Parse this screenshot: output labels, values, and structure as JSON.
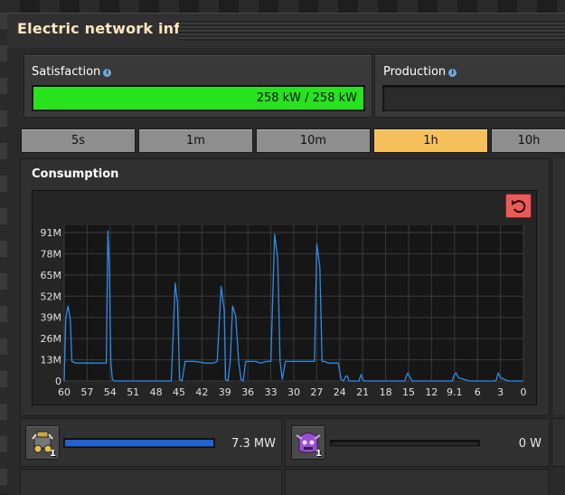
{
  "window": {
    "title": "Electric network info"
  },
  "satisfaction": {
    "label": "Satisfaction",
    "value_text": "258 kW / 258 kW",
    "fill": 1.0,
    "color": "#27e31e"
  },
  "production": {
    "label": "Production",
    "fill": 0.0
  },
  "time_tabs": [
    {
      "label": "5s",
      "active": false
    },
    {
      "label": "1m",
      "active": false
    },
    {
      "label": "10m",
      "active": false
    },
    {
      "label": "1h",
      "active": true
    },
    {
      "label": "10h",
      "active": false
    }
  ],
  "consumption": {
    "label": "Consumption",
    "reset_icon": "undo-icon"
  },
  "chart_data": {
    "type": "line",
    "title": "",
    "xlabel": "",
    "ylabel": "",
    "x_reversed": true,
    "xlim": [
      60,
      0
    ],
    "ylim": [
      0,
      91
    ],
    "y_unit": "M",
    "x_ticks": [
      "60",
      "57",
      "54",
      "51",
      "48",
      "45",
      "42",
      "39",
      "36",
      "33",
      "30",
      "27",
      "24",
      "21",
      "18",
      "15",
      "12",
      "9.1",
      "6",
      "3",
      "0"
    ],
    "y_ticks": [
      "0",
      "13M",
      "26M",
      "39M",
      "52M",
      "65M",
      "78M",
      "91M"
    ],
    "grid": true,
    "series": [
      {
        "color": "#2f8be8",
        "x": [
          60,
          59.8,
          59.5,
          59.2,
          59,
          58.5,
          57,
          56,
          55,
          54.5,
          54.3,
          54.1,
          53.9,
          53.7,
          53.4,
          52,
          50,
          48,
          46,
          45.5,
          45.2,
          44.9,
          44.6,
          44.2,
          43,
          41.5,
          40.5,
          40,
          39.5,
          39.1,
          38.9,
          38.6,
          38.3,
          38,
          37.6,
          37.2,
          36.9,
          36.6,
          36.3,
          36,
          35,
          34.3,
          33.6,
          33,
          32.5,
          32.1,
          31.8,
          31.5,
          31.1,
          30.5,
          29.5,
          28,
          27.3,
          27,
          26.6,
          26.3,
          26,
          25.5,
          24.2,
          23.8,
          23.5,
          23.2,
          23,
          22.8,
          22.5,
          21.5,
          21.2,
          21,
          20.8,
          20.5,
          19,
          17,
          15.5,
          15.3,
          15.1,
          14.8,
          14.5,
          13,
          10,
          9.3,
          9.1,
          8.8,
          8.5,
          7,
          5,
          3.7,
          3.5,
          3.3,
          3,
          2,
          0
        ],
        "y": [
          0,
          38,
          46,
          38,
          12,
          11,
          11,
          11,
          11,
          11,
          92,
          70,
          12,
          1,
          0,
          0,
          0,
          0,
          0,
          60,
          48,
          1,
          0,
          12,
          12,
          11,
          11,
          12,
          58,
          44,
          1,
          0,
          12,
          46,
          40,
          12,
          1,
          0,
          12,
          12,
          12,
          11,
          12,
          12,
          90,
          75,
          12,
          1,
          12,
          12,
          12,
          12,
          12,
          84,
          70,
          12,
          12,
          11,
          11,
          1,
          0,
          3,
          3,
          0,
          0,
          0,
          4,
          1,
          0,
          0,
          0,
          0,
          0,
          3,
          5,
          2,
          0,
          0,
          0,
          0,
          3,
          5,
          2,
          0,
          0,
          0,
          1,
          5,
          2,
          0,
          0
        ]
      }
    ]
  },
  "entries": [
    {
      "icon": "substation-machine-icon",
      "count": "1",
      "bar_fill": 1.0,
      "bar_color": "#1f63d6",
      "value": "7.3 MW"
    },
    {
      "icon": "purple-creature-icon",
      "count": "1",
      "bar_fill": 0.0,
      "bar_color": "#1f63d6",
      "value": "0 W"
    }
  ]
}
